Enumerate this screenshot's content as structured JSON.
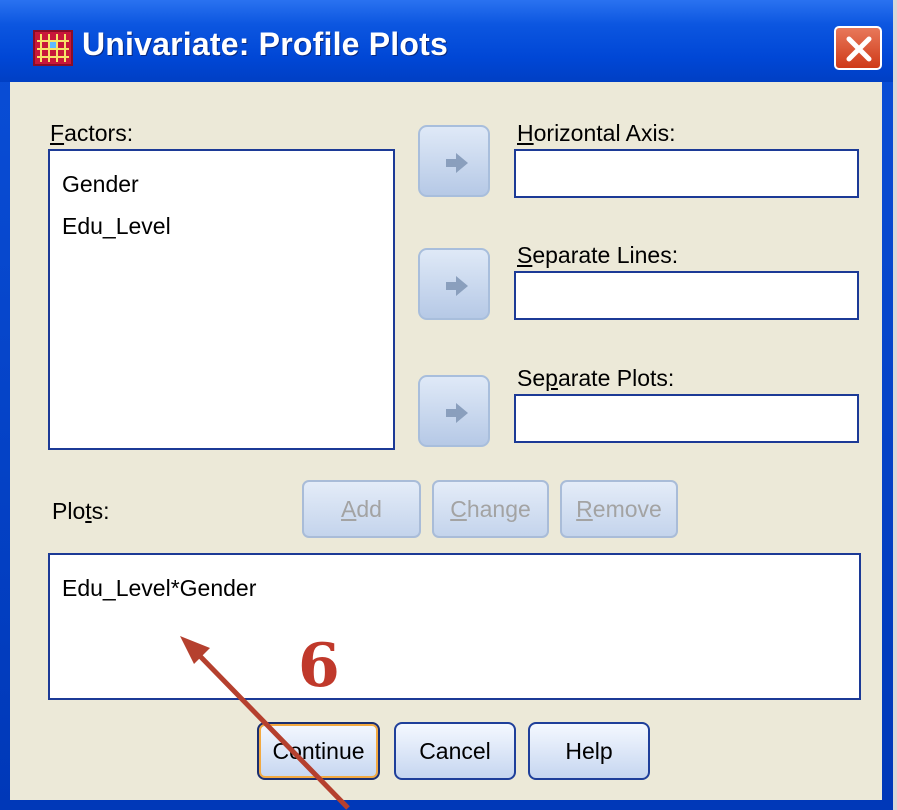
{
  "window": {
    "title": "Univariate: Profile Plots",
    "icon": "spss-grid-icon"
  },
  "factors": {
    "label": "Factors:",
    "items": [
      "Gender",
      "Edu_Level"
    ]
  },
  "horizontal_axis": {
    "label": "Horizontal Axis:",
    "value": ""
  },
  "separate_lines": {
    "label": "Separate Lines:",
    "value": ""
  },
  "separate_plots": {
    "label": "Separate Plots:",
    "value": ""
  },
  "plots": {
    "label": "Plots:",
    "items": [
      "Edu_Level*Gender"
    ],
    "add_label": "Add",
    "change_label": "Change",
    "remove_label": "Remove"
  },
  "buttons": {
    "continue": "Continue",
    "cancel": "Cancel",
    "help": "Help"
  },
  "annotation": {
    "number": "6",
    "color": "#c0392b"
  },
  "colors": {
    "titlebar": "#0047d6",
    "dialog_bg": "#ece9d8",
    "field_border": "#1c3a96"
  }
}
